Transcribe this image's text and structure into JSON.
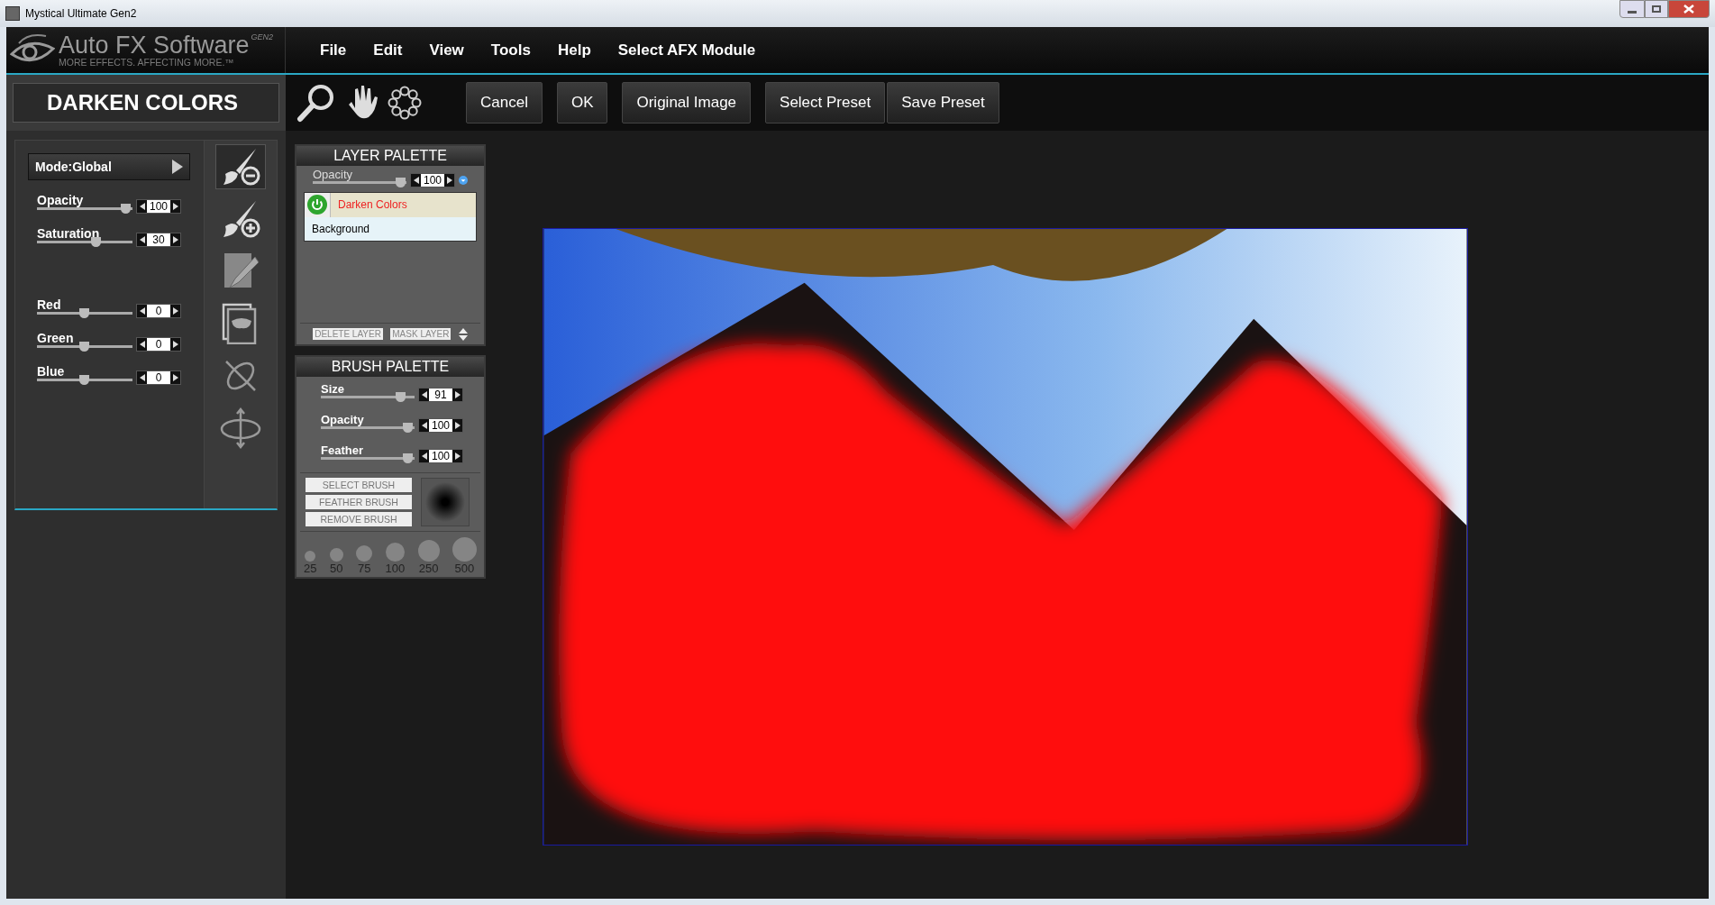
{
  "window": {
    "title": "Mystical Ultimate Gen2"
  },
  "logo": {
    "name": "Auto FX Software",
    "edition": "GEN2",
    "tagline": "MORE EFFECTS. AFFECTING MORE.™"
  },
  "menu": [
    "File",
    "Edit",
    "View",
    "Tools",
    "Help",
    "Select AFX Module"
  ],
  "effect": {
    "title": "DARKEN COLORS",
    "mode": "Mode:Global",
    "sliders": [
      {
        "label": "Opacity",
        "level": 0.92,
        "reading": "100"
      },
      {
        "label": "Saturation",
        "level": 0.61,
        "reading": "30"
      },
      {
        "label": "Red",
        "level": 0.49,
        "reading": "0"
      },
      {
        "label": "Green",
        "level": 0.49,
        "reading": "0"
      },
      {
        "label": "Blue",
        "level": 0.49,
        "reading": "0"
      }
    ],
    "tools": [
      {
        "kind": "brush-minus",
        "selected": true
      },
      {
        "kind": "brush-plus",
        "selected": false
      },
      {
        "kind": "pen",
        "selected": false
      },
      {
        "kind": "mask",
        "selected": false
      },
      {
        "kind": "cross",
        "selected": false
      },
      {
        "kind": "rotate",
        "selected": false
      }
    ]
  },
  "toolbar": {
    "buttons": [
      "Cancel",
      "OK",
      "Original Image",
      "Select Preset",
      "Save Preset"
    ]
  },
  "layer_palette": {
    "title": "LAYER PALETTE",
    "opacity": {
      "label": "Opacity",
      "level": 0.93,
      "reading": "100"
    },
    "layers": [
      {
        "name": "Darken Colors",
        "selected": true,
        "on": true
      },
      {
        "name": "Background",
        "selected": false
      }
    ],
    "buttons": [
      "DELETE LAYER",
      "MASK LAYER"
    ]
  },
  "brush_palette": {
    "title": "BRUSH PALETTE",
    "sliders": [
      {
        "label": "Size",
        "level": 0.85,
        "reading": "91"
      },
      {
        "label": "Opacity",
        "level": 0.92,
        "reading": "100"
      },
      {
        "label": "Feather",
        "level": 0.92,
        "reading": "100"
      }
    ],
    "buttons": [
      "SELECT BRUSH",
      "FEATHER BRUSH",
      "REMOVE BRUSH"
    ],
    "sizes": [
      "25",
      "50",
      "75",
      "100",
      "250",
      "500"
    ]
  }
}
